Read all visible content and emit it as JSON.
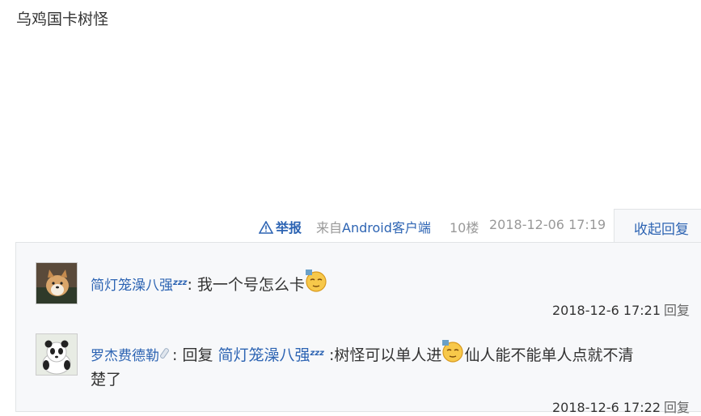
{
  "post": {
    "content": "乌鸡国卡树怪"
  },
  "tail": {
    "report": "举报",
    "from_prefix": "来自",
    "client": "Android客户端",
    "floor": "10楼",
    "time": "2018-12-06 17:19",
    "collapse": "收起回复"
  },
  "comments": [
    {
      "user": "简灯笼澡八强",
      "user_badge": "zzz",
      "separator": ":",
      "text": " 我一个号怎么卡",
      "time": "2018-12-6 17:21",
      "reply": "回复"
    },
    {
      "user": "罗杰费德勒",
      "separator": ":",
      "reply_prefix": " 回复 ",
      "reply_to": "简灯笼澡八强",
      "reply_to_badge": "zzz",
      "text_a": " :树怪可以单人进",
      "text_b": "仙人能不能单人点就不清",
      "text_c": "楚了",
      "time": "2018-12-6 17:22",
      "reply": "回复"
    }
  ],
  "colors": {
    "link": "#2d64b3",
    "muted": "#999999",
    "panel": "#f7f8fa",
    "border": "#e1e4e6"
  },
  "icons": [
    "warning-icon",
    "sleepy-emoji-icon",
    "pacifier-icon"
  ]
}
